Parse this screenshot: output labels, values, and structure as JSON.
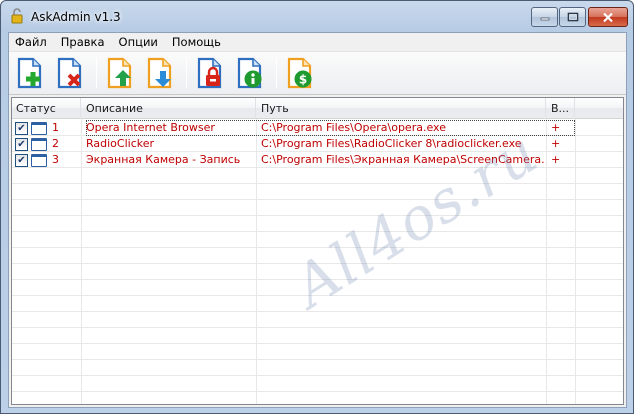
{
  "window": {
    "title": "AskAdmin v1.3"
  },
  "menu": {
    "items": [
      "Файл",
      "Правка",
      "Опции",
      "Помощь"
    ]
  },
  "toolbar": {
    "buttons": [
      "add-program",
      "remove-program",
      "move-up",
      "move-down",
      "block",
      "info",
      "donate"
    ]
  },
  "list": {
    "columns": [
      "Статус",
      "Описание",
      "Путь",
      "В..."
    ],
    "rows": [
      {
        "num": "1",
        "checked": true,
        "description": "Opera Internet Browser",
        "path": "C:\\Program Files\\Opera\\opera.exe",
        "flag": "+"
      },
      {
        "num": "2",
        "checked": true,
        "description": "RadioClicker",
        "path": "C:\\Program Files\\RadioClicker 8\\radioclicker.exe",
        "flag": "+"
      },
      {
        "num": "3",
        "checked": true,
        "description": "Экранная Камера - Запись",
        "path": "C:\\Program Files\\Экранная Камера\\ScreenCamera.exe",
        "flag": "+"
      }
    ]
  },
  "watermark": "All4os.ru",
  "colors": {
    "row_text": "#c00000",
    "titlebar": "#b9cde5"
  }
}
